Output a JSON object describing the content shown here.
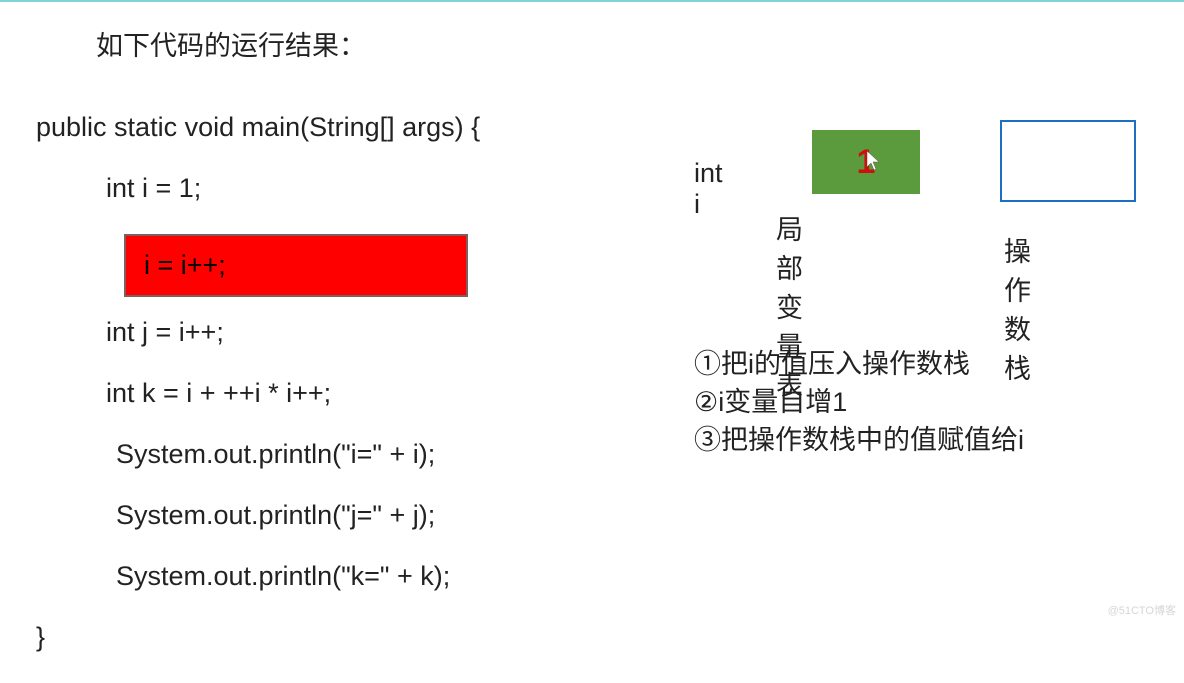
{
  "title": "如下代码的运行结果：",
  "code": {
    "sig": "public static void main(String[] args) {",
    "l1": "int i = 1;",
    "l2": "i = i++;",
    "l3": "int j = i++;",
    "l4": "int k = i + ++i * i++;",
    "l5": "System.out.println(\"i=\" + i);",
    "l6": "System.out.println(\"j=\" + j);",
    "l7": "System.out.println(\"k=\" + k);",
    "end": "}"
  },
  "right": {
    "var_label": "int  i",
    "green_value": "1",
    "green_caption": "局部变量表",
    "blue_caption": "操作数栈"
  },
  "steps": {
    "s1": "①把i的值压入操作数栈",
    "s2": "②i变量自增1",
    "s3": "③把操作数栈中的值赋值给i"
  },
  "watermark": "@51CTO博客"
}
